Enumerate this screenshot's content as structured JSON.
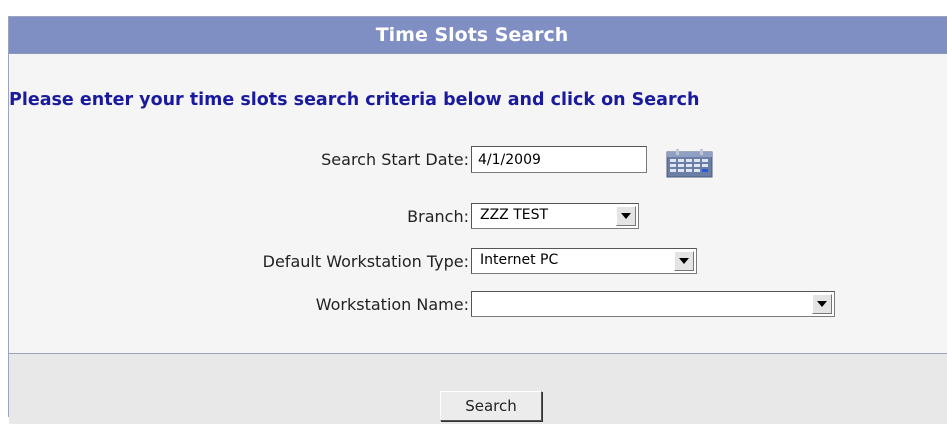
{
  "header": {
    "title": "Time Slots Search"
  },
  "instructions": "Please enter your time slots search criteria below and click on Search",
  "form": {
    "start_date_label": "Search Start Date:",
    "start_date_value": "4/1/2009",
    "branch_label": "Branch:",
    "branch_value": "ZZZ TEST",
    "workstation_type_label": "Default Workstation Type:",
    "workstation_type_value": "Internet PC",
    "workstation_name_label": "Workstation Name:",
    "workstation_name_value": ""
  },
  "footer": {
    "search_label": "Search"
  },
  "icons": {
    "calendar": "calendar-icon",
    "dropdown": "chevron-down-icon"
  },
  "colors": {
    "header_bg": "#7f8fc3",
    "instruction_text": "#1a1a9e",
    "panel_bg": "#f5f5f5"
  }
}
